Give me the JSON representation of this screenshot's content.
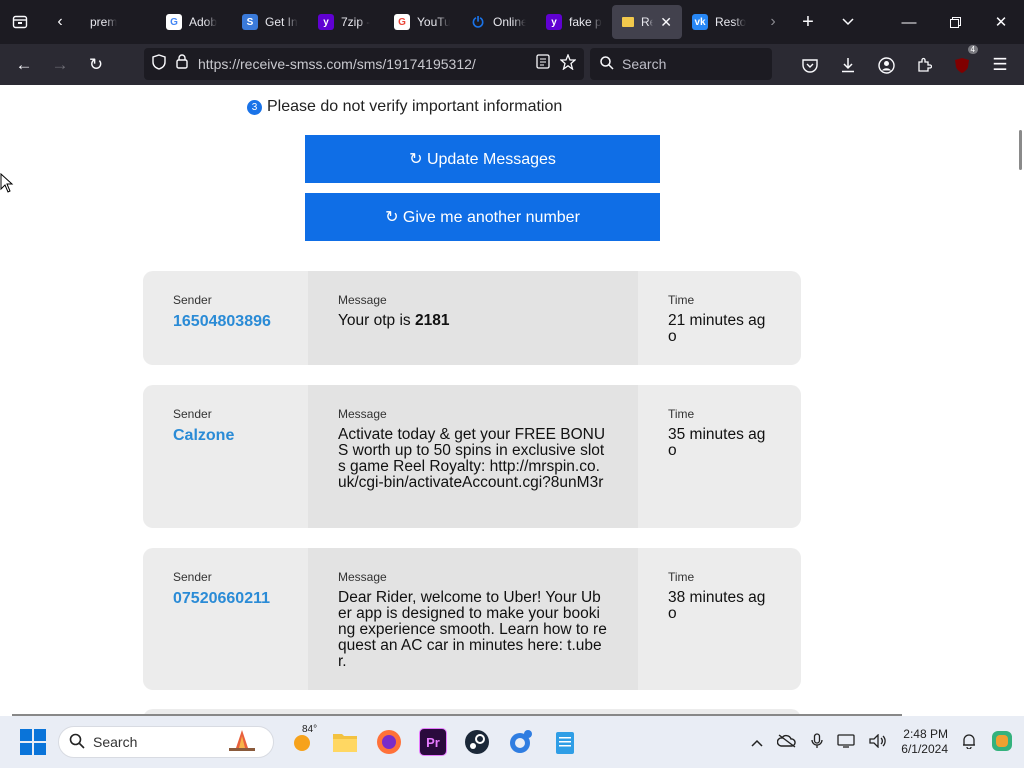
{
  "browser": {
    "tabs": [
      {
        "label": "prem",
        "favicon": "generic"
      },
      {
        "label": "Adob",
        "favicon": "google",
        "color": "#f4b400"
      },
      {
        "label": "Get In",
        "favicon": "sharepoint",
        "color": "#3a7ad9"
      },
      {
        "label": "7zip -",
        "favicon": "yahoo",
        "color": "#6001d2"
      },
      {
        "label": "YouTu",
        "favicon": "google",
        "color": "#ea4335"
      },
      {
        "label": "Online",
        "favicon": "power",
        "color": "#1a73e8"
      },
      {
        "label": "fake p",
        "favicon": "yahoo",
        "color": "#6001d2"
      },
      {
        "label": "Rec",
        "favicon": "flag",
        "color": "#f2c94c",
        "active": true
      },
      {
        "label": "Resto",
        "favicon": "vk",
        "color": "#2787f5"
      }
    ],
    "url": "https://receive-smss.com/sms/19174195312/",
    "search_placeholder": "Search",
    "extension_badge": "4"
  },
  "page": {
    "info_number": "3",
    "info_text": "Please do not verify important information",
    "update_button": "↻ Update Messages",
    "another_number_button": "↻ Give me another number",
    "column_labels": {
      "sender": "Sender",
      "message": "Message",
      "time": "Time"
    },
    "messages": [
      {
        "sender": "16504803896",
        "message_prefix": "Your otp is ",
        "message_bold": "2181",
        "time": "21 minutes ago"
      },
      {
        "sender": "Calzone",
        "message_prefix": "Activate today & get your FREE BONUS worth up to 50 spins in exclusive slots game Reel Royalty: http://mrspin.co.uk/cgi-bin/activateAccount.cgi?8unM3r",
        "message_bold": "",
        "time": "35 minutes ago"
      },
      {
        "sender": "07520660211",
        "message_prefix": "Dear Rider, welcome to Uber! Your Uber app is designed to make your booking experience smooth. Learn how to request an AC car in minutes here: t.uber.",
        "message_bold": "",
        "time": "38 minutes ago"
      }
    ]
  },
  "taskbar": {
    "search_label": "Search",
    "weather_temp": "84°",
    "time": "2:48 PM",
    "date": "6/1/2024"
  },
  "colors": {
    "accent_button": "#0f6ee6",
    "sender_link": "#2a8bd6"
  }
}
